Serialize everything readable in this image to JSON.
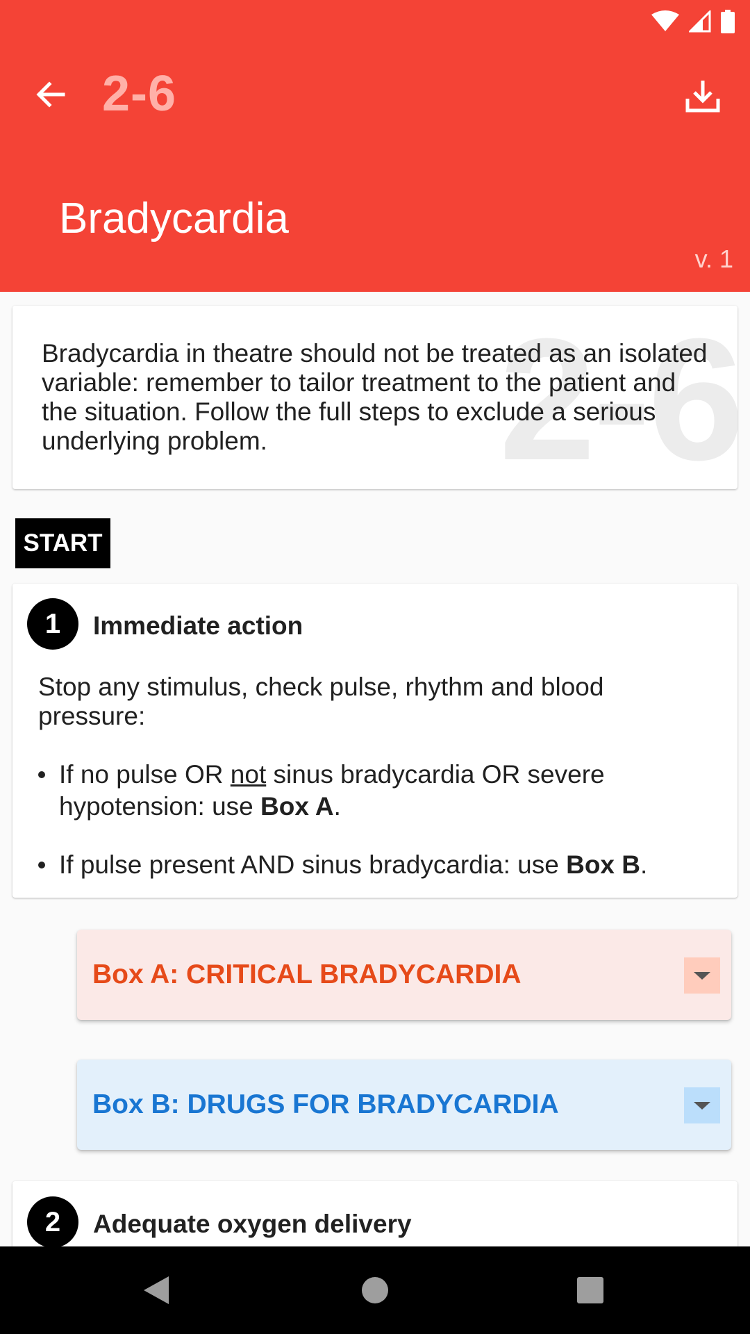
{
  "header": {
    "code": "2-6",
    "title": "Bradycardia",
    "version": "v. 1"
  },
  "intro": {
    "watermark": "2-6",
    "text": "Bradycardia in theatre should not be treated as an isolated variable: remember to tailor treatment to the patient and the situation. Follow the full steps to exclude a serious underlying problem."
  },
  "start_label": "START",
  "steps": [
    {
      "number": "1",
      "title": "Immediate action",
      "description": "Stop any stimulus, check pulse, rhythm and blood pressure:",
      "bullets": [
        {
          "part1": "If no pulse OR ",
          "underlined": "not",
          "part2": " sinus bradycardia OR severe hypotension: use ",
          "bold": "Box A",
          "end": "."
        },
        {
          "part1": "If pulse present AND sinus bradycardia: use ",
          "bold": "Box B",
          "end": "."
        }
      ]
    },
    {
      "number": "2",
      "title": "Adequate oxygen delivery"
    }
  ],
  "boxes": [
    {
      "label": "Box A: CRITICAL BRADYCARDIA",
      "color": "#e64a19",
      "bg": "#fbe9e7"
    },
    {
      "label": "Box B: DRUGS FOR BRADYCARDIA",
      "color": "#1976d2",
      "bg": "#e3f0fb"
    }
  ],
  "colors": {
    "header_bg": "#f44336",
    "accent_code": "#ffb0a8"
  },
  "icons": {
    "back": "arrow-left-icon",
    "download": "download-icon",
    "wifi": "wifi-icon",
    "signal": "signal-icon",
    "battery": "battery-icon",
    "nav_back": "nav-back-icon",
    "nav_home": "nav-home-icon",
    "nav_recents": "nav-recents-icon"
  }
}
